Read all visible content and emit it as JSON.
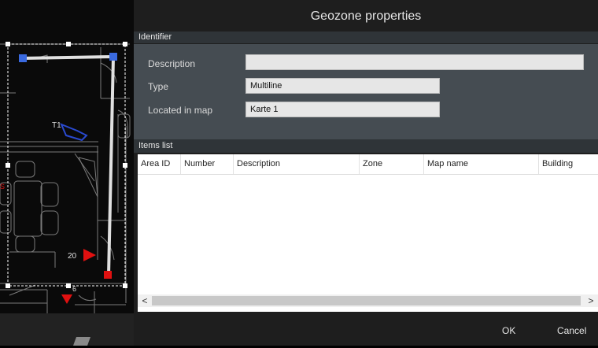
{
  "dialog": {
    "title": "Geozone properties",
    "identifier_header": "Identifier",
    "description_label": "Description",
    "description_value": "",
    "type_label": "Type",
    "type_value": "Multiline",
    "located_label": "Located in map",
    "located_value": "Karte 1",
    "items_header": "Items list",
    "columns": [
      "Area ID",
      "Number",
      "Description",
      "Zone",
      "Map name",
      "Building"
    ],
    "scroll_left": "<",
    "scroll_right": ">",
    "ok_label": "OK",
    "cancel_label": "Cancel"
  },
  "map": {
    "label_t1": "T1",
    "label_20": "20",
    "label_6": "6",
    "label_s": "S"
  },
  "colors": {
    "dialog_bg": "#1e1e1e",
    "section_header": "#2f3438",
    "identifier_panel": "#454c52",
    "geozone_line": "#e0e0e0",
    "node_blue": "#3a6ae0",
    "node_red": "#e01010"
  }
}
